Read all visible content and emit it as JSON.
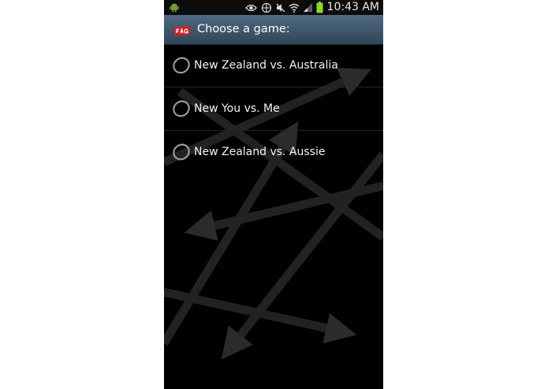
{
  "status_bar": {
    "time": "10:43 AM",
    "icons": [
      "android-debug-icon",
      "eye-icon",
      "data-sync-icon",
      "mute-icon",
      "wifi-icon",
      "signal-icon",
      "battery-icon"
    ]
  },
  "title_bar": {
    "title": "Choose a game:",
    "logo_icon": "app-logo-icon"
  },
  "games": [
    {
      "label": "New Zealand vs. Australia",
      "selected": false
    },
    {
      "label": "New You vs. Me",
      "selected": false
    },
    {
      "label": "New Zealand vs. Aussie",
      "selected": false
    }
  ],
  "colors": {
    "background": "#000000",
    "title_bar_top": "#4e6a82",
    "title_bar_bottom": "#324556",
    "logo_red": "#d81e1e",
    "battery_green": "#8ed436"
  }
}
